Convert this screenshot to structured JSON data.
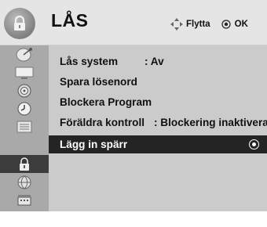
{
  "header": {
    "title": "LÅS",
    "hint_move_label": "Flytta",
    "hint_ok_label": "OK",
    "icon": "lock-icon"
  },
  "sidebar": {
    "items": [
      {
        "icon": "satellite-dish-icon",
        "active": false
      },
      {
        "icon": "tv-picture-icon",
        "active": false
      },
      {
        "icon": "speaker-icon",
        "active": false
      },
      {
        "icon": "clock-icon",
        "active": false
      },
      {
        "icon": "settings-icon",
        "active": false
      },
      {
        "icon": "lock-icon",
        "active": true
      },
      {
        "icon": "globe-icon",
        "active": false
      },
      {
        "icon": "usb-icon",
        "active": false
      }
    ]
  },
  "menu": {
    "items": [
      {
        "label": "Lås system",
        "value": ": Av"
      },
      {
        "label": "Spara lösenord",
        "value": ""
      },
      {
        "label": "Blockera Program",
        "value": ""
      },
      {
        "label": "Föräldra kontroll",
        "value": ": Blockering inaktiverad"
      },
      {
        "label": "Lägg in spärr",
        "value": "",
        "selected": true
      }
    ]
  },
  "colors": {
    "header_bg": "#e5e5e5",
    "sidebar_bg": "#a9a9a9",
    "menu_bg": "#cbcbcb",
    "selected_bg": "#242424"
  }
}
